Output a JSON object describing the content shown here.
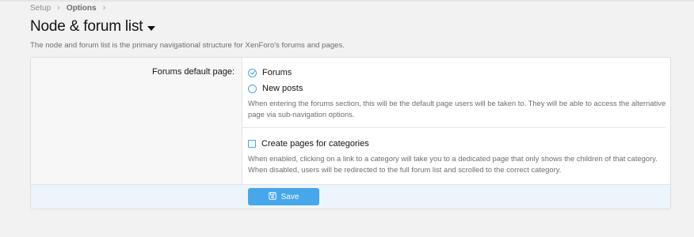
{
  "breadcrumb": {
    "items": [
      "Setup",
      "Options"
    ]
  },
  "page": {
    "title": "Node & forum list",
    "description": "The node and forum list is the primary navigational structure for XenForo's forums and pages."
  },
  "forums_default_page": {
    "label": "Forums default page:",
    "options": [
      "Forums",
      "New posts"
    ],
    "selected": "Forums",
    "explain": "When entering the forums section, this will be the default page users will be taken to. They will be able to access the alternative page via sub-navigation options."
  },
  "create_pages": {
    "label": "Create pages for categories",
    "checked": false,
    "explain": "When enabled, clicking on a link to a category will take you to a dedicated page that only shows the children of that category. When disabled, users will be redirected to the full forum list and scrolled to the correct category."
  },
  "footer": {
    "save_label": "Save"
  },
  "icons": {
    "selected_radio": "check-circle-icon",
    "radio": "radio-icon",
    "checkbox": "checkbox-icon",
    "save": "save-icon",
    "title_menu": "caret-down-icon"
  },
  "colors": {
    "accent": "#47a7eb",
    "footer_bg": "#edf5fc"
  }
}
